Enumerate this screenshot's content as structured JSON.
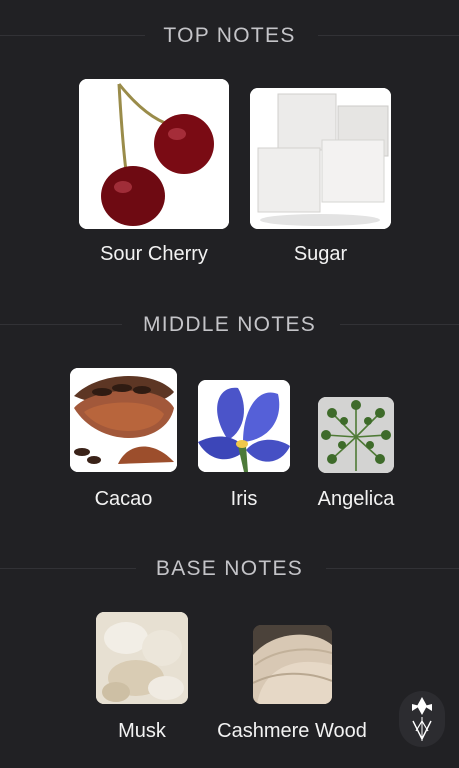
{
  "sections": [
    {
      "title": "TOP NOTES",
      "notes": [
        {
          "label": "Sour Cherry",
          "icon": "cherry-image"
        },
        {
          "label": "Sugar",
          "icon": "sugar-cubes-image"
        }
      ]
    },
    {
      "title": "MIDDLE NOTES",
      "notes": [
        {
          "label": "Cacao",
          "icon": "cacao-image"
        },
        {
          "label": "Iris",
          "icon": "iris-flower-image"
        },
        {
          "label": "Angelica",
          "icon": "angelica-plant-image"
        }
      ]
    },
    {
      "title": "BASE NOTES",
      "notes": [
        {
          "label": "Musk",
          "icon": "musk-image"
        },
        {
          "label": "Cashmere Wood",
          "icon": "cashmere-wood-image"
        }
      ]
    }
  ],
  "colors": {
    "background": "#212124",
    "header_text": "#c4c4c8",
    "label_text": "#f2f2f2"
  },
  "brand_logo": "fragrance-brand-logo-icon"
}
